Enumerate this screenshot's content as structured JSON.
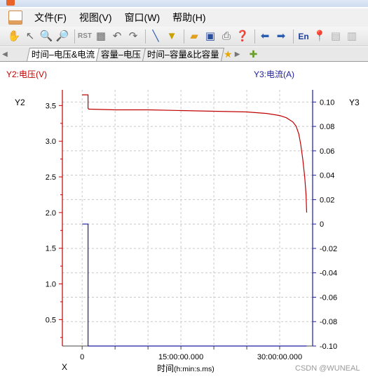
{
  "menu": {
    "items": [
      "文件(F)",
      "视图(V)",
      "窗口(W)",
      "帮助(H)"
    ]
  },
  "tabs": {
    "items": [
      "时间–电压&电流",
      "容量–电压",
      "时间–容量&比容量"
    ],
    "active_index": 0
  },
  "toolbar": {
    "icons": [
      "hand-icon",
      "pointer-icon",
      "zoom-in-icon",
      "zoom-out-icon",
      "reset-icon",
      "fit-icon",
      "undo-icon",
      "redo-icon",
      "line-icon",
      "filter-icon",
      "open-folder-icon",
      "save-icon",
      "print-icon",
      "help-icon",
      "back-icon",
      "forward-icon",
      "language-icon",
      "pin-icon",
      "layout-a-icon",
      "layout-b-icon"
    ],
    "rst_label": "RST",
    "en_label": "En"
  },
  "chart_data": {
    "type": "line",
    "left_axis_title": "Y2:电压(V)",
    "right_axis_title": "Y3:电流(A)",
    "left_axis_name": "Y2",
    "right_axis_name": "Y3",
    "x_axis_name": "X",
    "xlabel_main": "时间",
    "xlabel_unit": "(h:min:s.ms)",
    "x_unit": "minutes",
    "xlim": [
      -3,
      35
    ],
    "x_ticks": [
      0,
      15,
      30
    ],
    "x_tick_labels": [
      "0",
      "15:00:00.000",
      "30:00:00.000"
    ],
    "y_left_lim": [
      0.13,
      3.72
    ],
    "y_left_ticks": [
      0.5,
      1.0,
      1.5,
      2.0,
      2.5,
      3.0,
      3.5
    ],
    "y_left_tick_labels": [
      "0.5",
      "1.0",
      "1.5",
      "2.0",
      "2.5",
      "3.0",
      "3.5"
    ],
    "y_right_lim": [
      -0.1,
      0.11
    ],
    "y_right_ticks": [
      -0.1,
      -0.08,
      -0.06,
      -0.04,
      -0.02,
      0,
      0.02,
      0.04,
      0.06,
      0.08,
      0.1
    ],
    "y_right_tick_labels": [
      "-0.10",
      "-0.08",
      "-0.06",
      "-0.04",
      "-0.02",
      "0",
      "0.02",
      "0.04",
      "0.06",
      "0.08",
      "0.10"
    ],
    "grid": true,
    "series": [
      {
        "axis": "left",
        "color": "#c00000",
        "x": [
          0,
          0.9,
          0.9,
          1.0,
          5,
          10,
          15,
          20,
          25,
          28,
          30,
          31,
          32,
          32.5,
          32.9,
          33.2,
          33.5,
          33.8,
          34.0,
          34.1
        ],
        "y": [
          3.65,
          3.65,
          3.46,
          3.45,
          3.44,
          3.44,
          3.43,
          3.42,
          3.41,
          3.39,
          3.36,
          3.33,
          3.27,
          3.21,
          3.1,
          2.95,
          2.75,
          2.5,
          2.25,
          2.0
        ]
      },
      {
        "axis": "right",
        "color": "#1c1ca0",
        "x": [
          0,
          0.9,
          0.9,
          34.1
        ],
        "y": [
          0,
          0,
          -0.1,
          -0.1
        ]
      }
    ]
  },
  "watermark": "CSDN @WUNEAL"
}
